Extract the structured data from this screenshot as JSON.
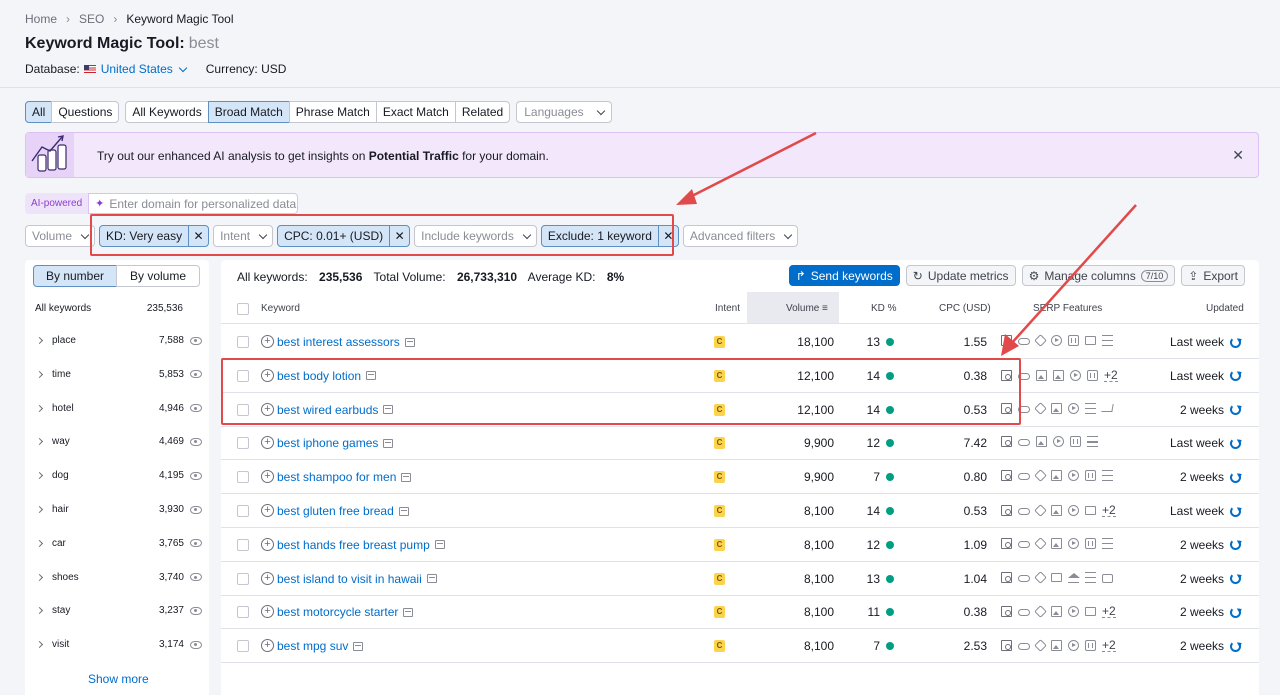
{
  "breadcrumb": [
    "Home",
    "SEO",
    "Keyword Magic Tool"
  ],
  "page": {
    "title": "Keyword Magic Tool:",
    "keyword": "best"
  },
  "database": {
    "label": "Database:",
    "value": "United States",
    "currency": "Currency: USD"
  },
  "tabs": {
    "group1": [
      "All",
      "Questions"
    ],
    "group2": [
      "All Keywords",
      "Broad Match",
      "Phrase Match",
      "Exact Match",
      "Related"
    ],
    "languages": "Languages"
  },
  "banner": {
    "prefix": "Try out our enhanced AI analysis to get insights on ",
    "bold": "Potential Traffic",
    "suffix": " for your domain."
  },
  "ai": {
    "badge": "AI-powered",
    "placeholder": "Enter domain for personalized data"
  },
  "filters": {
    "volume": "Volume",
    "kd": "KD: Very easy",
    "intent": "Intent",
    "cpc": "CPC: 0.01+ (USD)",
    "include": "Include keywords",
    "exclude": "Exclude: 1 keyword",
    "advanced": "Advanced filters"
  },
  "sidebar": {
    "by_number": "By number",
    "by_volume": "By volume",
    "head_label": "All keywords",
    "head_count": "235,536",
    "items": [
      {
        "name": "place",
        "count": "7,588"
      },
      {
        "name": "time",
        "count": "5,853"
      },
      {
        "name": "hotel",
        "count": "4,946"
      },
      {
        "name": "way",
        "count": "4,469"
      },
      {
        "name": "dog",
        "count": "4,195"
      },
      {
        "name": "hair",
        "count": "3,930"
      },
      {
        "name": "car",
        "count": "3,765"
      },
      {
        "name": "shoes",
        "count": "3,740"
      },
      {
        "name": "stay",
        "count": "3,237"
      },
      {
        "name": "visit",
        "count": "3,174"
      }
    ],
    "show_more": "Show more"
  },
  "summary": {
    "all_label": "All keywords:",
    "all_value": "235,536",
    "vol_label": "Total Volume:",
    "vol_value": "26,733,310",
    "kd_label": "Average KD:",
    "kd_value": "8%"
  },
  "actions": {
    "send": "Send keywords",
    "update": "Update metrics",
    "manage": "Manage columns",
    "manage_count": "7/10",
    "export": "Export"
  },
  "columns": {
    "keyword": "Keyword",
    "intent": "Intent",
    "volume": "Volume",
    "kd": "KD %",
    "cpc": "CPC (USD)",
    "serp": "SERP Features",
    "updated": "Updated"
  },
  "rows": [
    {
      "keyword": "best interest assessors",
      "intent": "C",
      "volume": "18,100",
      "kd": "13",
      "cpc": "1.55",
      "serp": [
        "fs",
        "link",
        "star",
        "play",
        "vid",
        "msg",
        "list"
      ],
      "more": "",
      "updated": "Last week"
    },
    {
      "keyword": "best body lotion",
      "intent": "C",
      "volume": "12,100",
      "kd": "14",
      "cpc": "0.38",
      "serp": [
        "fs",
        "link",
        "img",
        "img",
        "play",
        "vid"
      ],
      "more": "+2",
      "updated": "Last week"
    },
    {
      "keyword": "best wired earbuds",
      "intent": "C",
      "volume": "12,100",
      "kd": "14",
      "cpc": "0.53",
      "serp": [
        "fs",
        "link",
        "star",
        "img",
        "play",
        "list",
        "cart"
      ],
      "more": "",
      "updated": "2 weeks"
    },
    {
      "keyword": "best iphone games",
      "intent": "C",
      "volume": "9,900",
      "kd": "12",
      "cpc": "7.42",
      "serp": [
        "fs",
        "link",
        "img",
        "play",
        "vid",
        "list"
      ],
      "more": "",
      "updated": "Last week"
    },
    {
      "keyword": "best shampoo for men",
      "intent": "C",
      "volume": "9,900",
      "kd": "7",
      "cpc": "0.80",
      "serp": [
        "fs",
        "link",
        "star",
        "img",
        "play",
        "vid",
        "list"
      ],
      "more": "",
      "updated": "2 weeks"
    },
    {
      "keyword": "best gluten free bread",
      "intent": "C",
      "volume": "8,100",
      "kd": "14",
      "cpc": "0.53",
      "serp": [
        "fs",
        "link",
        "star",
        "img",
        "play",
        "msg"
      ],
      "more": "+2",
      "updated": "Last week"
    },
    {
      "keyword": "best hands free breast pump",
      "intent": "C",
      "volume": "8,100",
      "kd": "12",
      "cpc": "1.09",
      "serp": [
        "fs",
        "link",
        "star",
        "img",
        "play",
        "vid",
        "list"
      ],
      "more": "",
      "updated": "2 weeks"
    },
    {
      "keyword": "best island to visit in hawaii",
      "intent": "C",
      "volume": "8,100",
      "kd": "13",
      "cpc": "1.04",
      "serp": [
        "fs",
        "link",
        "star",
        "msg",
        "cap",
        "list",
        "bag"
      ],
      "more": "",
      "updated": "2 weeks"
    },
    {
      "keyword": "best motorcycle starter",
      "intent": "C",
      "volume": "8,100",
      "kd": "11",
      "cpc": "0.38",
      "serp": [
        "fs",
        "link",
        "star",
        "img",
        "play",
        "msg"
      ],
      "more": "+2",
      "updated": "2 weeks"
    },
    {
      "keyword": "best mpg suv",
      "intent": "C",
      "volume": "8,100",
      "kd": "7",
      "cpc": "2.53",
      "serp": [
        "fs",
        "link",
        "star",
        "img",
        "play",
        "vid"
      ],
      "more": "+2",
      "updated": "2 weeks"
    }
  ]
}
